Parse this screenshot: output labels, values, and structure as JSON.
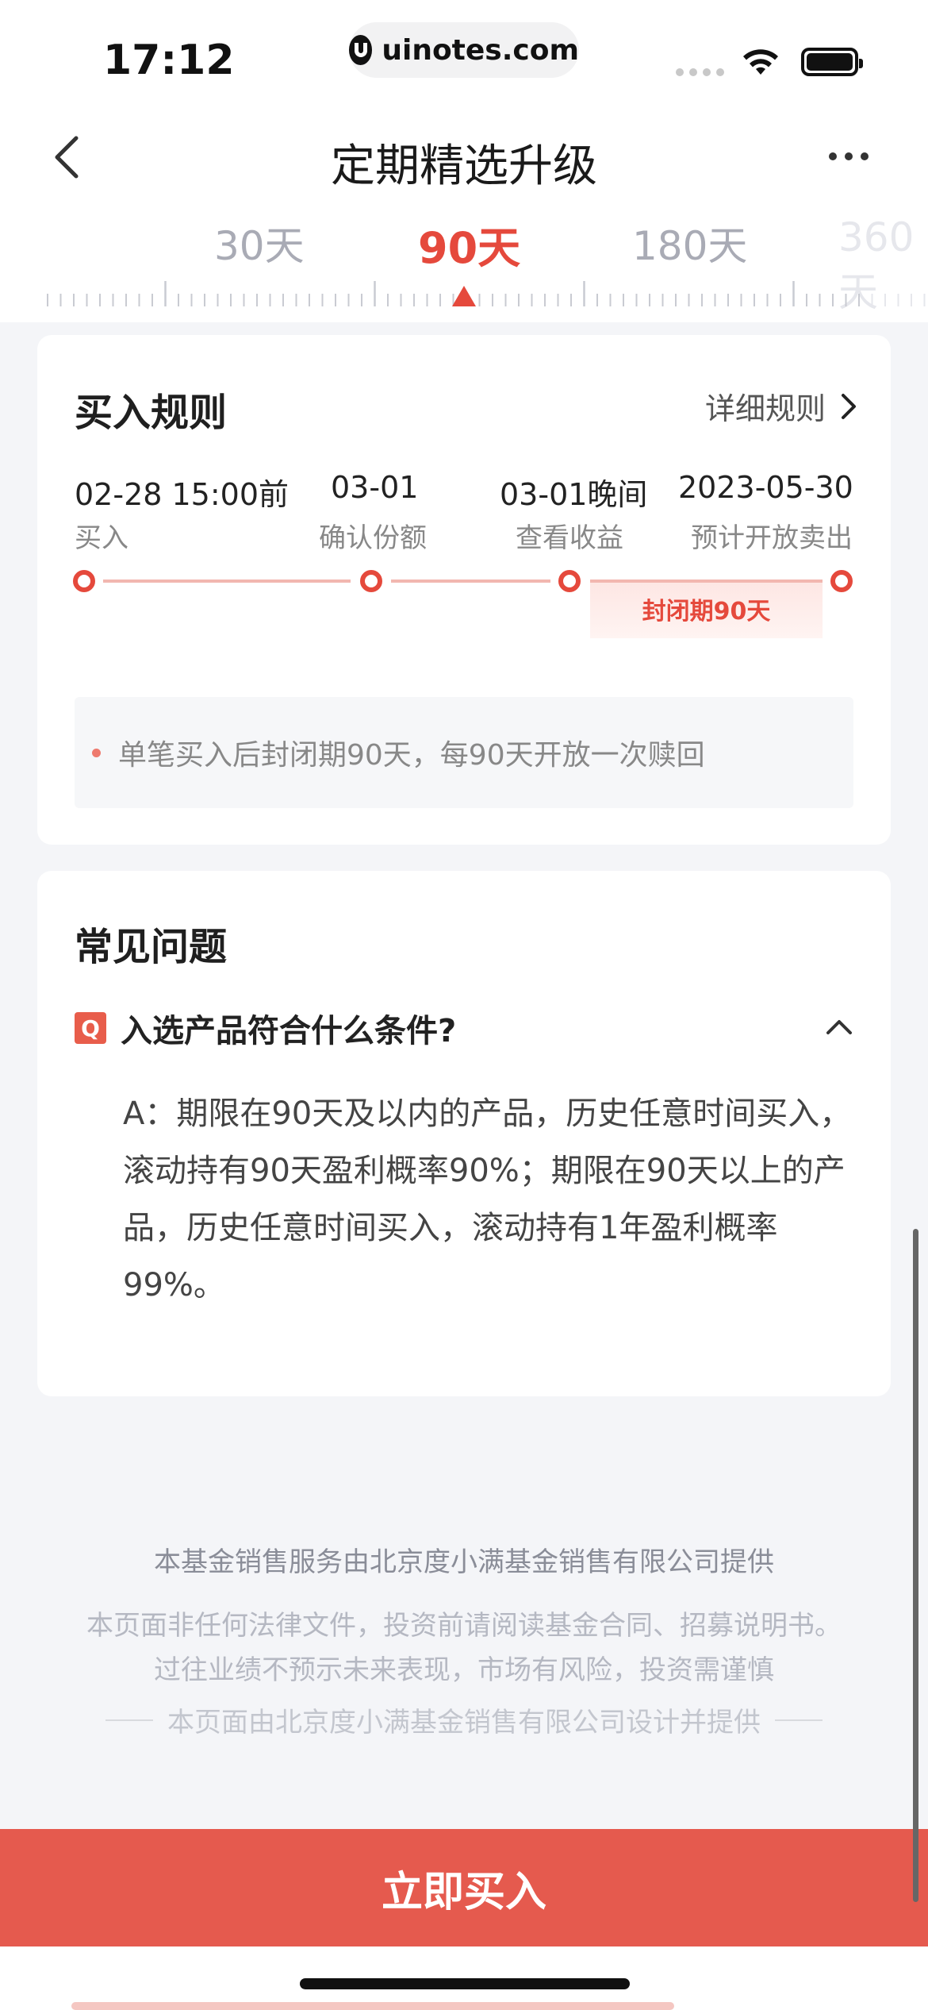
{
  "status_bar": {
    "time": "17:12",
    "url": "uinotes.com"
  },
  "nav": {
    "title": "定期精选升级"
  },
  "periods": [
    {
      "label": "30天",
      "state": "normal"
    },
    {
      "label": "90天",
      "state": "active"
    },
    {
      "label": "180天",
      "state": "normal"
    },
    {
      "label": "360天",
      "state": "faded"
    }
  ],
  "buy_rules": {
    "title": "买入规则",
    "detail_link": "详细规则",
    "steps": [
      {
        "date": "02-28 15:00前",
        "label": "买入"
      },
      {
        "date": "03-01",
        "label": "确认份额"
      },
      {
        "date": "03-01晚间",
        "label": "查看收益"
      },
      {
        "date": "2023-05-30",
        "label": "预计开放卖出"
      }
    ],
    "closed_period": "封闭期90天",
    "note": "单笔买入后封闭期90天，每90天开放一次赎回"
  },
  "faq": {
    "title": "常见问题",
    "q_badge": "Q",
    "question": "入选产品符合什么条件?",
    "answer": "A：期限在90天及以内的产品，历史任意时间买入，滚动持有90天盈利概率90%；期限在90天以上的产品，历史任意时间买入，滚动持有1年盈利概率99%。"
  },
  "footer": {
    "line1": "本基金销售服务由北京度小满基金销售有限公司提供",
    "line2": "本页面非任何法律文件，投资前请阅读基金合同、招募说明书。",
    "line3": "过往业绩不预示未来表现，市场有风险，投资需谨慎",
    "line4": "本页面由北京度小满基金销售有限公司设计并提供"
  },
  "buy_button": "立即买入",
  "colors": {
    "accent": "#e5493c",
    "button": "#e55a4e",
    "background": "#f4f5f8"
  }
}
